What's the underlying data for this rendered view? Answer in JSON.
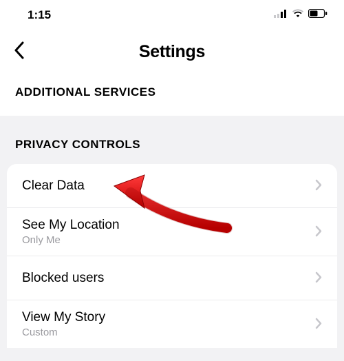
{
  "status_bar": {
    "time": "1:15"
  },
  "header": {
    "title": "Settings"
  },
  "section1": {
    "title": "ADDITIONAL SERVICES"
  },
  "section2": {
    "title": "PRIVACY CONTROLS",
    "rows": [
      {
        "label": "Clear Data",
        "sub": ""
      },
      {
        "label": "See My Location",
        "sub": "Only Me"
      },
      {
        "label": "Blocked users",
        "sub": ""
      },
      {
        "label": "View My Story",
        "sub": "Custom"
      }
    ]
  }
}
